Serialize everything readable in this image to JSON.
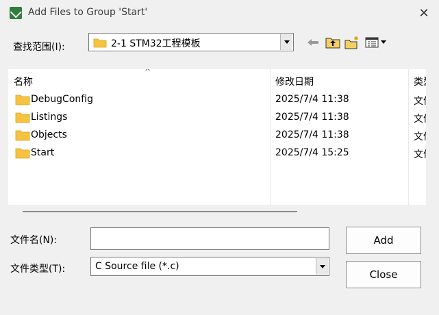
{
  "window": {
    "title": "Add Files to Group 'Start'"
  },
  "look_in": {
    "label": "查找范围(I):",
    "value": "2-1 STM32工程模板"
  },
  "toolbar": {
    "back_icon": "back-arrow-icon",
    "up_icon": "up-one-level-icon",
    "new_folder_icon": "new-folder-icon",
    "view_icon": "view-menu-icon"
  },
  "list": {
    "headers": {
      "name": "名称",
      "date": "修改日期",
      "type": "类型"
    },
    "rows": [
      {
        "name": "DebugConfig",
        "date": "2025/7/4 11:38",
        "type": "文件夹"
      },
      {
        "name": "Listings",
        "date": "2025/7/4 11:38",
        "type": "文件夹"
      },
      {
        "name": "Objects",
        "date": "2025/7/4 11:38",
        "type": "文件夹"
      },
      {
        "name": "Start",
        "date": "2025/7/4 15:25",
        "type": "文件夹"
      }
    ]
  },
  "file_name": {
    "label": "文件名(N):",
    "value": ""
  },
  "file_type": {
    "label": "文件类型(T):",
    "value": "C Source file (*.c)"
  },
  "buttons": {
    "add": "Add",
    "close": "Close"
  },
  "colors": {
    "folder": "#f5c242",
    "background": "#f0f0f0"
  }
}
